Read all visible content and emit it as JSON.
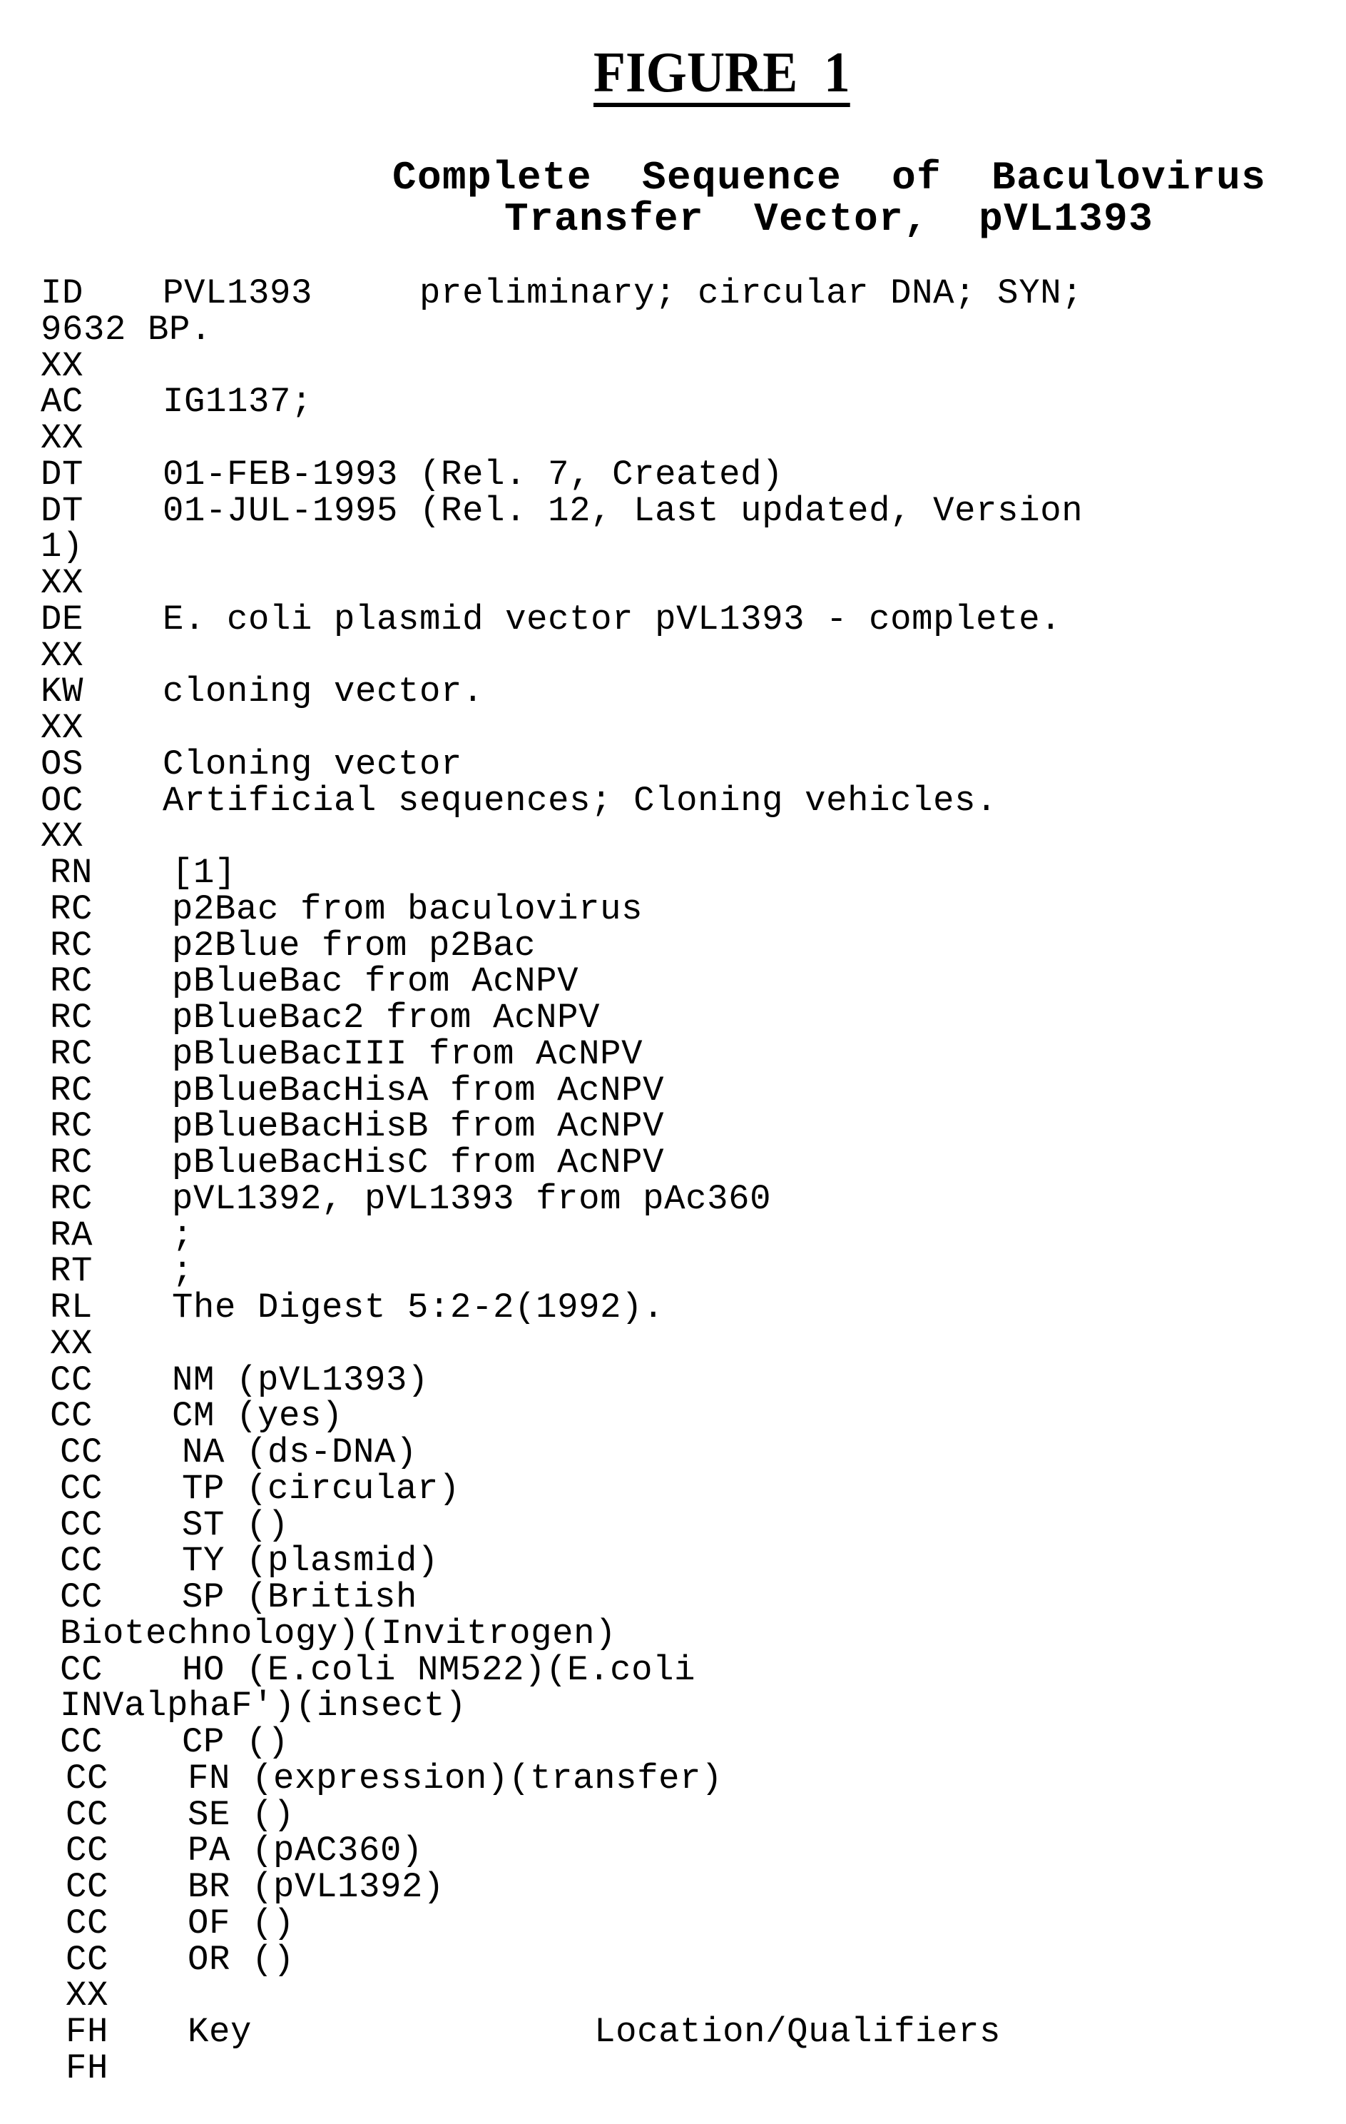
{
  "figure": {
    "label": "FIGURE  1",
    "subtitle_lines": [
      "Complete  Sequence  of  Baculovirus",
      "Transfer  Vector,  pVL1393"
    ]
  },
  "record": [
    {
      "tag": "ID",
      "text": "PVL1393     preliminary; circular DNA; SYN;"
    },
    {
      "tag": "",
      "text": "9632 BP.",
      "wrap": true
    },
    {
      "tag": "XX",
      "text": ""
    },
    {
      "tag": "AC",
      "text": "IG1137;"
    },
    {
      "tag": "XX",
      "text": ""
    },
    {
      "tag": "DT",
      "text": "01-FEB-1993 (Rel. 7, Created)"
    },
    {
      "tag": "DT",
      "text": "01-JUL-1995 (Rel. 12, Last updated, Version"
    },
    {
      "tag": "",
      "text": "1)",
      "wrap": true
    },
    {
      "tag": "XX",
      "text": ""
    },
    {
      "tag": "DE",
      "text": "E. coli plasmid vector pVL1393 - complete."
    },
    {
      "tag": "XX",
      "text": ""
    },
    {
      "tag": "KW",
      "text": "cloning vector."
    },
    {
      "tag": "XX",
      "text": ""
    },
    {
      "tag": "OS",
      "text": "Cloning vector"
    },
    {
      "tag": "OC",
      "text": "Artificial sequences; Cloning vehicles."
    },
    {
      "tag": "XX",
      "text": ""
    },
    {
      "tag": "RN",
      "text": "[1]"
    },
    {
      "tag": "RC",
      "text": "p2Bac from baculovirus"
    },
    {
      "tag": "RC",
      "text": "p2Blue from p2Bac"
    },
    {
      "tag": "RC",
      "text": "pBlueBac from AcNPV"
    },
    {
      "tag": "RC",
      "text": "pBlueBac2 from AcNPV"
    },
    {
      "tag": "RC",
      "text": "pBlueBacIII from AcNPV"
    },
    {
      "tag": "RC",
      "text": "pBlueBacHisA from AcNPV"
    },
    {
      "tag": "RC",
      "text": "pBlueBacHisB from AcNPV"
    },
    {
      "tag": "RC",
      "text": "pBlueBacHisC from AcNPV"
    },
    {
      "tag": "RC",
      "text": "pVL1392, pVL1393 from pAc360"
    },
    {
      "tag": "RA",
      "text": ";"
    },
    {
      "tag": "RT",
      "text": ";"
    },
    {
      "tag": "RL",
      "text": "The Digest 5:2-2(1992)."
    },
    {
      "tag": "XX",
      "text": ""
    },
    {
      "tag": "CC",
      "text": "NM (pVL1393)"
    },
    {
      "tag": "CC",
      "text": "CM (yes)"
    },
    {
      "tag": "CC",
      "text": "NA (ds-DNA)"
    },
    {
      "tag": "CC",
      "text": "TP (circular)"
    },
    {
      "tag": "CC",
      "text": "ST ()"
    },
    {
      "tag": "CC",
      "text": "TY (plasmid)"
    },
    {
      "tag": "CC",
      "text": "SP (British"
    },
    {
      "tag": "",
      "text": "Biotechnology)(Invitrogen)",
      "wrap": true
    },
    {
      "tag": "CC",
      "text": "HO (E.coli NM522)(E.coli"
    },
    {
      "tag": "",
      "text": "INValphaF')(insect)",
      "wrap": true
    },
    {
      "tag": "CC",
      "text": "CP ()"
    },
    {
      "tag": "CC",
      "text": "FN (expression)(transfer)"
    },
    {
      "tag": "CC",
      "text": "SE ()"
    },
    {
      "tag": "CC",
      "text": "PA (pAC360)"
    },
    {
      "tag": "CC",
      "text": "BR (pVL1392)"
    },
    {
      "tag": "CC",
      "text": "OF ()"
    },
    {
      "tag": "CC",
      "text": "OR ()"
    },
    {
      "tag": "XX",
      "text": ""
    },
    {
      "tag": "FH",
      "text": "Key                Location/Qualifiers"
    },
    {
      "tag": "FH",
      "text": ""
    }
  ]
}
